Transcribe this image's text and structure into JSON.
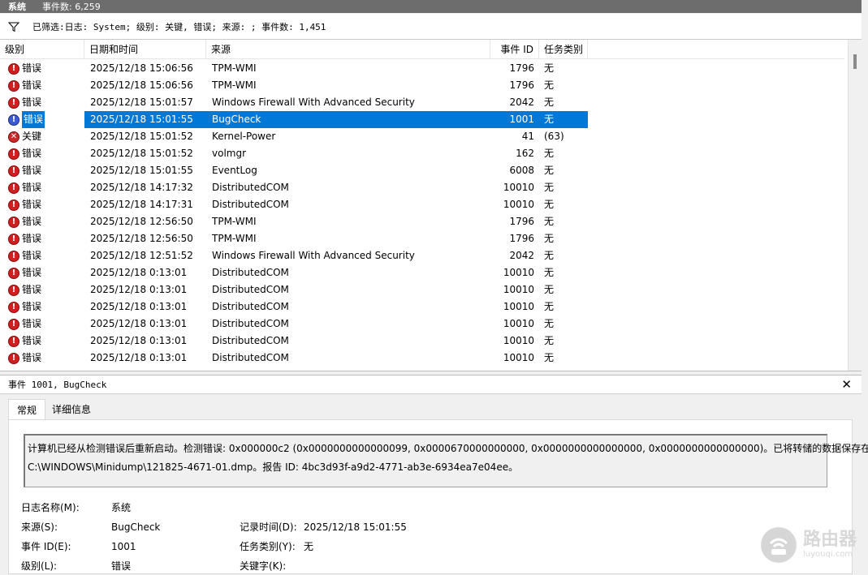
{
  "topbar": {
    "title": "系统",
    "event_count": "事件数: 6,259"
  },
  "filter": {
    "text": "已筛选:日志: System; 级别: 关键, 错误; 来源: ; 事件数: 1,451"
  },
  "columns": {
    "level": "级别",
    "date": "日期和时间",
    "source": "来源",
    "id": "事件 ID",
    "task": "任务类别"
  },
  "rows": [
    {
      "icon": "error-icon",
      "level": "错误",
      "date": "2025/12/18 15:06:56",
      "source": "TPM-WMI",
      "id": "1796",
      "task": "无"
    },
    {
      "icon": "error-icon",
      "level": "错误",
      "date": "2025/12/18 15:06:56",
      "source": "TPM-WMI",
      "id": "1796",
      "task": "无"
    },
    {
      "icon": "error-icon",
      "level": "错误",
      "date": "2025/12/18 15:01:57",
      "source": "Windows Firewall With Advanced Security",
      "id": "2042",
      "task": "无"
    },
    {
      "icon": "error-icon",
      "level": "错误",
      "date": "2025/12/18 15:01:55",
      "source": "BugCheck",
      "id": "1001",
      "task": "无",
      "selected": true
    },
    {
      "icon": "critical-icon",
      "level": "关键",
      "date": "2025/12/18 15:01:52",
      "source": "Kernel-Power",
      "id": "41",
      "task": "(63)"
    },
    {
      "icon": "error-icon",
      "level": "错误",
      "date": "2025/12/18 15:01:52",
      "source": "volmgr",
      "id": "162",
      "task": "无"
    },
    {
      "icon": "error-icon",
      "level": "错误",
      "date": "2025/12/18 15:01:55",
      "source": "EventLog",
      "id": "6008",
      "task": "无"
    },
    {
      "icon": "error-icon",
      "level": "错误",
      "date": "2025/12/18 14:17:32",
      "source": "DistributedCOM",
      "id": "10010",
      "task": "无"
    },
    {
      "icon": "error-icon",
      "level": "错误",
      "date": "2025/12/18 14:17:31",
      "source": "DistributedCOM",
      "id": "10010",
      "task": "无"
    },
    {
      "icon": "error-icon",
      "level": "错误",
      "date": "2025/12/18 12:56:50",
      "source": "TPM-WMI",
      "id": "1796",
      "task": "无"
    },
    {
      "icon": "error-icon",
      "level": "错误",
      "date": "2025/12/18 12:56:50",
      "source": "TPM-WMI",
      "id": "1796",
      "task": "无"
    },
    {
      "icon": "error-icon",
      "level": "错误",
      "date": "2025/12/18 12:51:52",
      "source": "Windows Firewall With Advanced Security",
      "id": "2042",
      "task": "无"
    },
    {
      "icon": "error-icon",
      "level": "错误",
      "date": "2025/12/18 0:13:01",
      "source": "DistributedCOM",
      "id": "10010",
      "task": "无"
    },
    {
      "icon": "error-icon",
      "level": "错误",
      "date": "2025/12/18 0:13:01",
      "source": "DistributedCOM",
      "id": "10010",
      "task": "无"
    },
    {
      "icon": "error-icon",
      "level": "错误",
      "date": "2025/12/18 0:13:01",
      "source": "DistributedCOM",
      "id": "10010",
      "task": "无"
    },
    {
      "icon": "error-icon",
      "level": "错误",
      "date": "2025/12/18 0:13:01",
      "source": "DistributedCOM",
      "id": "10010",
      "task": "无"
    },
    {
      "icon": "error-icon",
      "level": "错误",
      "date": "2025/12/18 0:13:01",
      "source": "DistributedCOM",
      "id": "10010",
      "task": "无"
    },
    {
      "icon": "error-icon",
      "level": "错误",
      "date": "2025/12/18 0:13:01",
      "source": "DistributedCOM",
      "id": "10010",
      "task": "无"
    }
  ],
  "detail": {
    "header": "事件 1001, BugCheck",
    "tab_general": "常规",
    "tab_details": "详细信息",
    "message_line1": "计算机已经从检测错误后重新启动。检测错误: 0x000000c2 (0x0000000000000099, 0x0000670000000000, 0x0000000000000000, 0x0000000000000000)。已将转储的数据保存在:",
    "message_line2": "C:\\WINDOWS\\Minidump\\121825-4671-01.dmp。报告 ID: 4bc3d93f-a9d2-4771-ab3e-6934ea7e04ee。",
    "log_name_label": "日志名称(M):",
    "log_name_value": "系统",
    "source_label": "来源(S):",
    "source_value": "BugCheck",
    "logged_label": "记录时间(D):",
    "logged_value": "2025/12/18 15:01:55",
    "event_id_label": "事件 ID(E):",
    "event_id_value": "1001",
    "task_label": "任务类别(Y):",
    "task_value": "无",
    "level_label": "级别(L):",
    "level_value": "错误",
    "keywords_label": "关键字(K):"
  },
  "watermark": {
    "big": "路由器",
    "small": "luyouqi.com"
  }
}
